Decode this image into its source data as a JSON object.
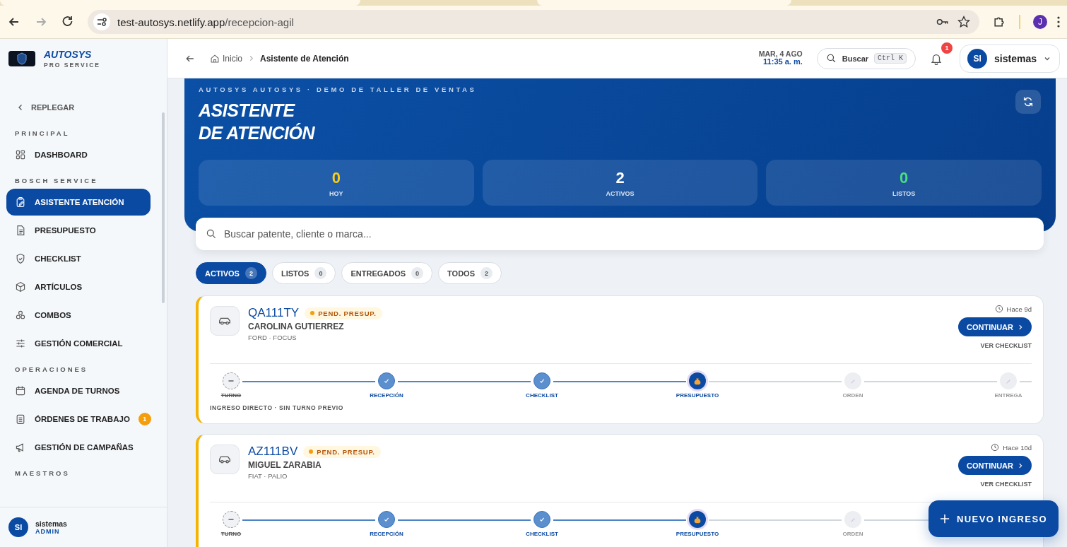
{
  "browser": {
    "url_host": "test-autosys.netlify.app",
    "url_path": "/recepcion-agil",
    "profile": "J"
  },
  "sidebar": {
    "brand": "AUTOSYS",
    "tagline": "PRO SERVICE",
    "collapse": "REPLEGAR",
    "sections": [
      {
        "title": "PRINCIPAL",
        "items": [
          {
            "label": "DASHBOARD",
            "selected": false
          }
        ]
      },
      {
        "title": "BOSCH SERVICE",
        "items": [
          {
            "label": "ASISTENTE ATENCIÓN",
            "selected": true
          },
          {
            "label": "PRESUPUESTO",
            "selected": false
          },
          {
            "label": "CHECKLIST",
            "selected": false
          },
          {
            "label": "ARTÍCULOS",
            "selected": false
          },
          {
            "label": "COMBOS",
            "selected": false
          },
          {
            "label": "GESTIÓN COMERCIAL",
            "selected": false
          }
        ]
      },
      {
        "title": "OPERACIONES",
        "items": [
          {
            "label": "AGENDA DE TURNOS",
            "selected": false
          },
          {
            "label": "ÓRDENES DE TRABAJO",
            "selected": false,
            "badge": "1"
          },
          {
            "label": "GESTIÓN DE CAMPAÑAS",
            "selected": false
          }
        ]
      },
      {
        "title": "MAESTROS"
      }
    ],
    "user": {
      "initials": "SI",
      "name": "sistemas",
      "role": "ADMIN"
    }
  },
  "header": {
    "breadcrumb": [
      {
        "label": "Inicio"
      },
      {
        "label": "Asistente de Atención"
      }
    ],
    "date": "MAR, 4 AGO",
    "time": "11:35 a. m.",
    "search_label": "Buscar",
    "shortcut": "Ctrl K",
    "notifications": "1",
    "user": {
      "initials": "SI",
      "name": "sistemas"
    }
  },
  "hero": {
    "subtitle": "AUTOSYS AUTOSYS · DEMO DE TALLER DE VENTAS",
    "title_lines": [
      "ASISTENTE",
      "DE ATENCIÓN"
    ],
    "stats": [
      {
        "value": "0",
        "label": "HOY",
        "color": "#facc15"
      },
      {
        "value": "2",
        "label": "ACTIVOS",
        "color": "#ffffff"
      },
      {
        "value": "0",
        "label": "LISTOS",
        "color": "#4ade80"
      }
    ]
  },
  "search": {
    "placeholder": "Buscar patente, cliente o marca..."
  },
  "tabs": [
    {
      "label": "ACTIVOS",
      "count": "2",
      "selected": true
    },
    {
      "label": "LISTOS",
      "count": "0",
      "selected": false
    },
    {
      "label": "ENTREGADOS",
      "count": "0",
      "selected": false
    },
    {
      "label": "TODOS",
      "count": "2",
      "selected": false
    }
  ],
  "cards": [
    {
      "plate": "QA111TY",
      "status": "PEND. PRESUP.",
      "client": "CAROLINA GUTIERREZ",
      "vehicle": "FORD · FOCUS",
      "age": "Hace 9d",
      "action": "CONTINUAR",
      "link": "VER CHECKLIST",
      "note": "INGRESO DIRECTO · SIN TURNO PREVIO",
      "steps": [
        {
          "label": "TURNO",
          "kind": "skipped"
        },
        {
          "label": "RECEPCIÓN",
          "kind": "done"
        },
        {
          "label": "CHECKLIST",
          "kind": "done"
        },
        {
          "label": "PRESUPUESTO",
          "kind": "current"
        },
        {
          "label": "ORDEN",
          "kind": "pending"
        },
        {
          "label": "ENTREGA",
          "kind": "pending"
        }
      ]
    },
    {
      "plate": "AZ111BV",
      "status": "PEND. PRESUP.",
      "client": "MIGUEL ZARABIA",
      "vehicle": "FIAT · PALIO",
      "age": "Hace 10d",
      "action": "CONTINUAR",
      "link": "VER CHECKLIST",
      "steps": [
        {
          "label": "TURNO",
          "kind": "skipped"
        },
        {
          "label": "RECEPCIÓN",
          "kind": "done"
        },
        {
          "label": "CHECKLIST",
          "kind": "done"
        },
        {
          "label": "PRESUPUESTO",
          "kind": "current"
        },
        {
          "label": "ORDEN",
          "kind": "pending"
        }
      ]
    }
  ],
  "fab": {
    "label": "NUEVO INGRESO"
  }
}
